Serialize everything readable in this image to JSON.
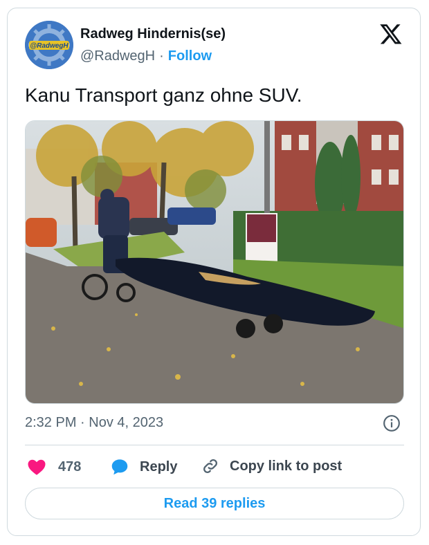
{
  "author": {
    "name": "Radweg Hindernis(se)",
    "handle": "@RadwegH",
    "separator": "·",
    "follow_label": "Follow",
    "avatar_text": "@RadwegH"
  },
  "tweet": {
    "text": "Kanu Transport ganz ohne SUV.",
    "timestamp": "2:32 PM · Nov 4, 2023",
    "photo_description_icon": "photo"
  },
  "actions": {
    "likes_count": "478",
    "reply_label": "Reply",
    "copy_label": "Copy link to post",
    "read_replies_label": "Read 39 replies"
  },
  "icons": {
    "logo": "x-logo-icon",
    "like": "heart-icon",
    "reply": "speech-bubble-icon",
    "copy": "link-icon",
    "info": "info-icon"
  },
  "colors": {
    "accent": "#1d9bf0",
    "like": "#f91880",
    "muted": "#536471",
    "border": "#cfd9de"
  }
}
